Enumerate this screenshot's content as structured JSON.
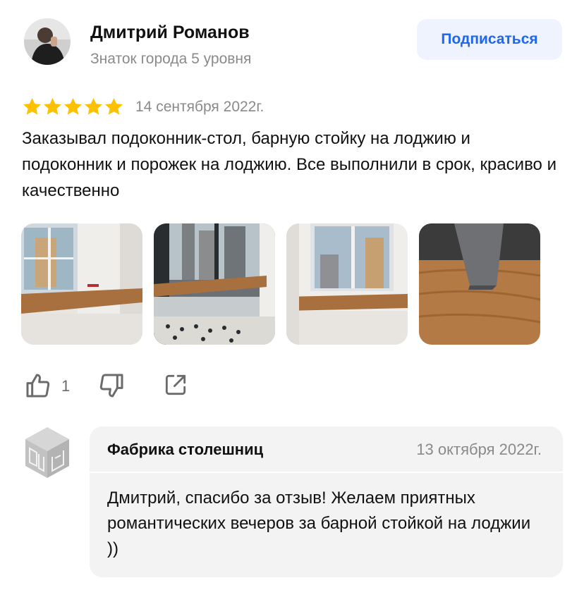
{
  "author": {
    "name": "Дмитрий Романов",
    "level": "Знаток города 5 уровня",
    "avatar_icon": "user-avatar-photo"
  },
  "subscribe_label": "Подписаться",
  "review": {
    "rating": 5,
    "max_rating": 5,
    "star_color": "#fcc100",
    "date": "14 сентября 2022г.",
    "text": "Заказывал подоконник-стол, барную стойку на лоджию и подоконник и порожек на лоджию. Все выполнили в срок, красиво и качественно"
  },
  "photos": [
    {
      "name": "photo-windowsill-desk"
    },
    {
      "name": "photo-balcony-bar"
    },
    {
      "name": "photo-windowsill"
    },
    {
      "name": "photo-wood-closeup"
    }
  ],
  "actions": {
    "like_icon": "thumbs-up-icon",
    "like_count": "1",
    "dislike_icon": "thumbs-down-icon",
    "share_icon": "share-icon"
  },
  "reply": {
    "company": "Фабрика столешниц",
    "date": "13 октября 2022г.",
    "text": "Дмитрий, спасибо за отзыв! Желаем приятных романтических вечеров за барной стойкой на лоджии ))",
    "logo_icon": "company-cube-logo"
  },
  "colors": {
    "accent": "#1f66f0",
    "subscribe_bg": "#eef3fe",
    "muted_text": "#8a8a8a",
    "reply_bg": "#f3f3f3"
  }
}
